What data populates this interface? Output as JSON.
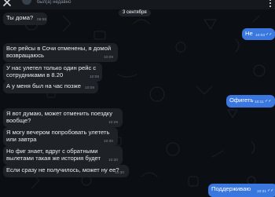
{
  "header": {
    "status": "был(а) недавно"
  },
  "date_divider": "3 сентября",
  "messages": [
    {
      "dir": "in",
      "text": [
        "Ты дома?"
      ],
      "time": "09:58"
    },
    {
      "dir": "out",
      "text": [
        "Не"
      ],
      "time": "10:03"
    },
    {
      "dir": "in",
      "text": [
        "Все рейсы в Сочи отменены, я домой",
        "возвращаюсь"
      ],
      "time": "10:09"
    },
    {
      "dir": "in",
      "text": [
        "У нас улетел только один рейс с",
        "сотрудниками в 8.20"
      ],
      "time": "10:09"
    },
    {
      "dir": "in",
      "text": [
        "А у меня был на час позже"
      ],
      "time": "10:09"
    },
    {
      "dir": "out",
      "text": [
        "Офигеть"
      ],
      "time": "10:11"
    },
    {
      "dir": "in",
      "text": [
        "Я вот думаю, может отменить поездку",
        "вообще?"
      ],
      "time": "10:29"
    },
    {
      "dir": "in",
      "text": [
        "Я могу вечером попробовать улететь",
        "или завтра"
      ],
      "time": "10:30"
    },
    {
      "dir": "in",
      "text": [
        "Но фиг знает, вдруг с обратными",
        "вылетами такая же история будет"
      ],
      "time": "10:30"
    },
    {
      "dir": "in",
      "text": [
        "Если сразу не получилось, может ну ее?"
      ],
      "time": "10:30"
    },
    {
      "dir": "out",
      "text": [
        "Поддерживаю"
      ],
      "time": "10:31"
    }
  ],
  "colors": {
    "background": "#0b0e12",
    "incoming": "#1e2227",
    "outgoing": "#3a78e0"
  }
}
